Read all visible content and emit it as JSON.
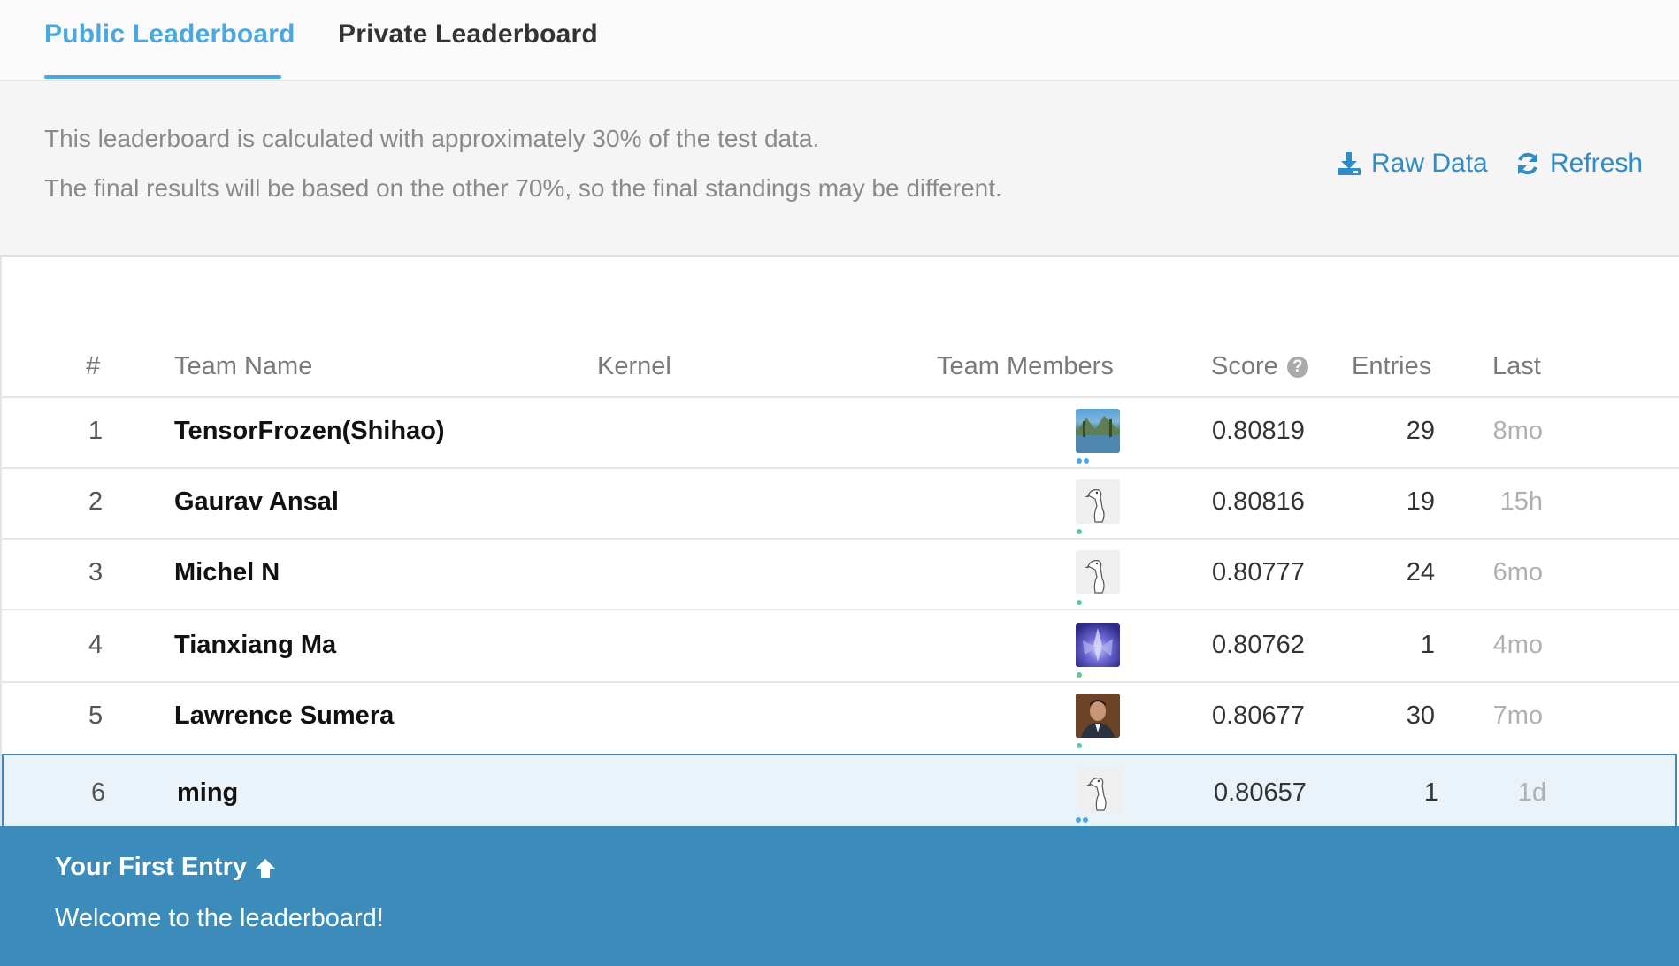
{
  "tabs": [
    {
      "label": "Public Leaderboard"
    },
    {
      "label": "Private Leaderboard"
    }
  ],
  "info": {
    "line1": "This leaderboard is calculated with approximately 30% of the test data.",
    "line2": "The final results will be based on the other 70%, so the final standings may be different.",
    "raw_data_label": "Raw Data",
    "refresh_label": "Refresh"
  },
  "table": {
    "headers": {
      "rank": "#",
      "team": "Team Name",
      "kernel": "Kernel",
      "members": "Team Members",
      "score": "Score",
      "entries": "Entries",
      "last": "Last"
    },
    "rows": [
      {
        "rank": "1",
        "team": "TensorFrozen(Shihao)",
        "score": "0.80819",
        "entries": "29",
        "last": "8mo"
      },
      {
        "rank": "2",
        "team": "Gaurav Ansal",
        "score": "0.80816",
        "entries": "19",
        "last": "15h"
      },
      {
        "rank": "3",
        "team": "Michel N",
        "score": "0.80777",
        "entries": "24",
        "last": "6mo"
      },
      {
        "rank": "4",
        "team": "Tianxiang Ma",
        "score": "0.80762",
        "entries": "1",
        "last": "4mo"
      },
      {
        "rank": "5",
        "team": "Lawrence Sumera",
        "score": "0.80677",
        "entries": "30",
        "last": "7mo"
      },
      {
        "rank": "6",
        "team": "ming",
        "score": "0.80657",
        "entries": "1",
        "last": "1d"
      }
    ]
  },
  "banner": {
    "title": "Your First Entry",
    "message": "Welcome to the leaderboard!"
  },
  "colors": {
    "accent": "#4aa8e0",
    "link": "#2f8cc4",
    "banner": "#3b8bbb",
    "highlight_row": "#eaf3fa"
  }
}
